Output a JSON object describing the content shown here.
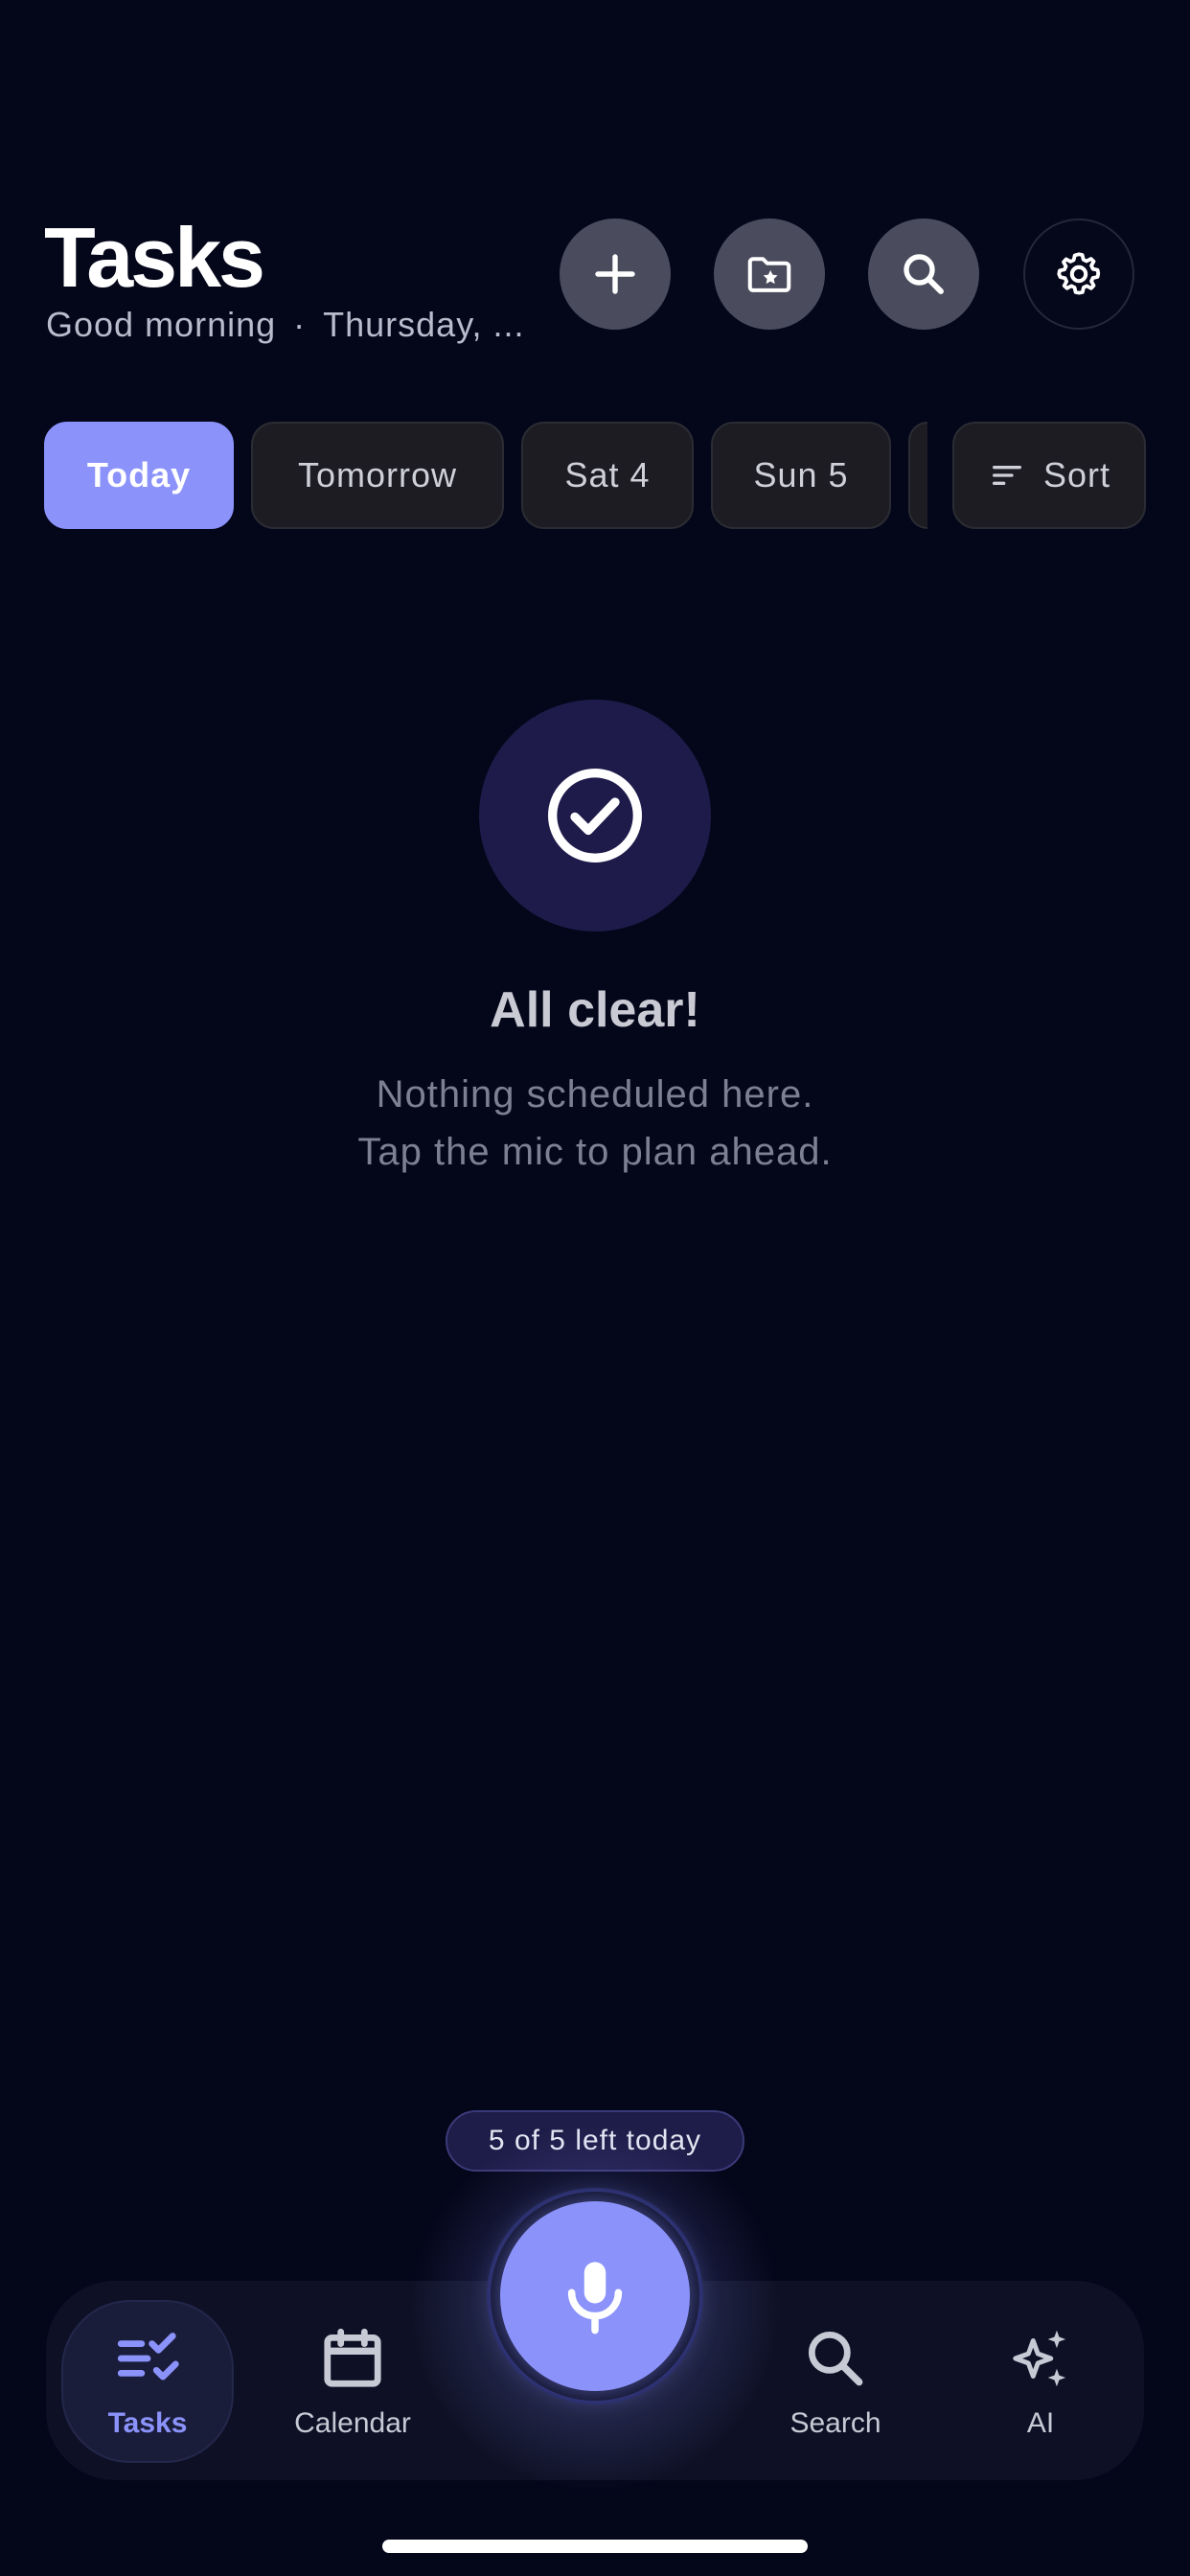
{
  "header": {
    "title": "Tasks",
    "greeting": "Good morning",
    "separator": "·",
    "date": "Thursday, ..."
  },
  "header_actions": [
    {
      "icon": "plus-icon"
    },
    {
      "icon": "folder-star-icon"
    },
    {
      "icon": "search-icon"
    },
    {
      "icon": "gear-icon"
    }
  ],
  "filters": {
    "chips": [
      "Today",
      "Tomorrow",
      "Sat 4",
      "Sun 5"
    ],
    "selected": "Today",
    "sort_label": "Sort"
  },
  "empty_state": {
    "icon": "check-circle-icon",
    "title": "All clear!",
    "line1": "Nothing scheduled here.",
    "line2": "Tap the mic to plan ahead."
  },
  "quota": {
    "text": "5 of 5 left today"
  },
  "nav": {
    "items": [
      {
        "label": "Tasks",
        "icon": "tasks-checklist-icon",
        "active": true
      },
      {
        "label": "Calendar",
        "icon": "calendar-icon"
      },
      {
        "label": "Search",
        "icon": "search-icon"
      },
      {
        "label": "AI",
        "icon": "sparkles-icon"
      }
    ],
    "mic_icon": "microphone-icon"
  },
  "colors": {
    "background": "#04061a",
    "accent": "#8b93fb",
    "empty_circle": "#1e1b4a"
  }
}
